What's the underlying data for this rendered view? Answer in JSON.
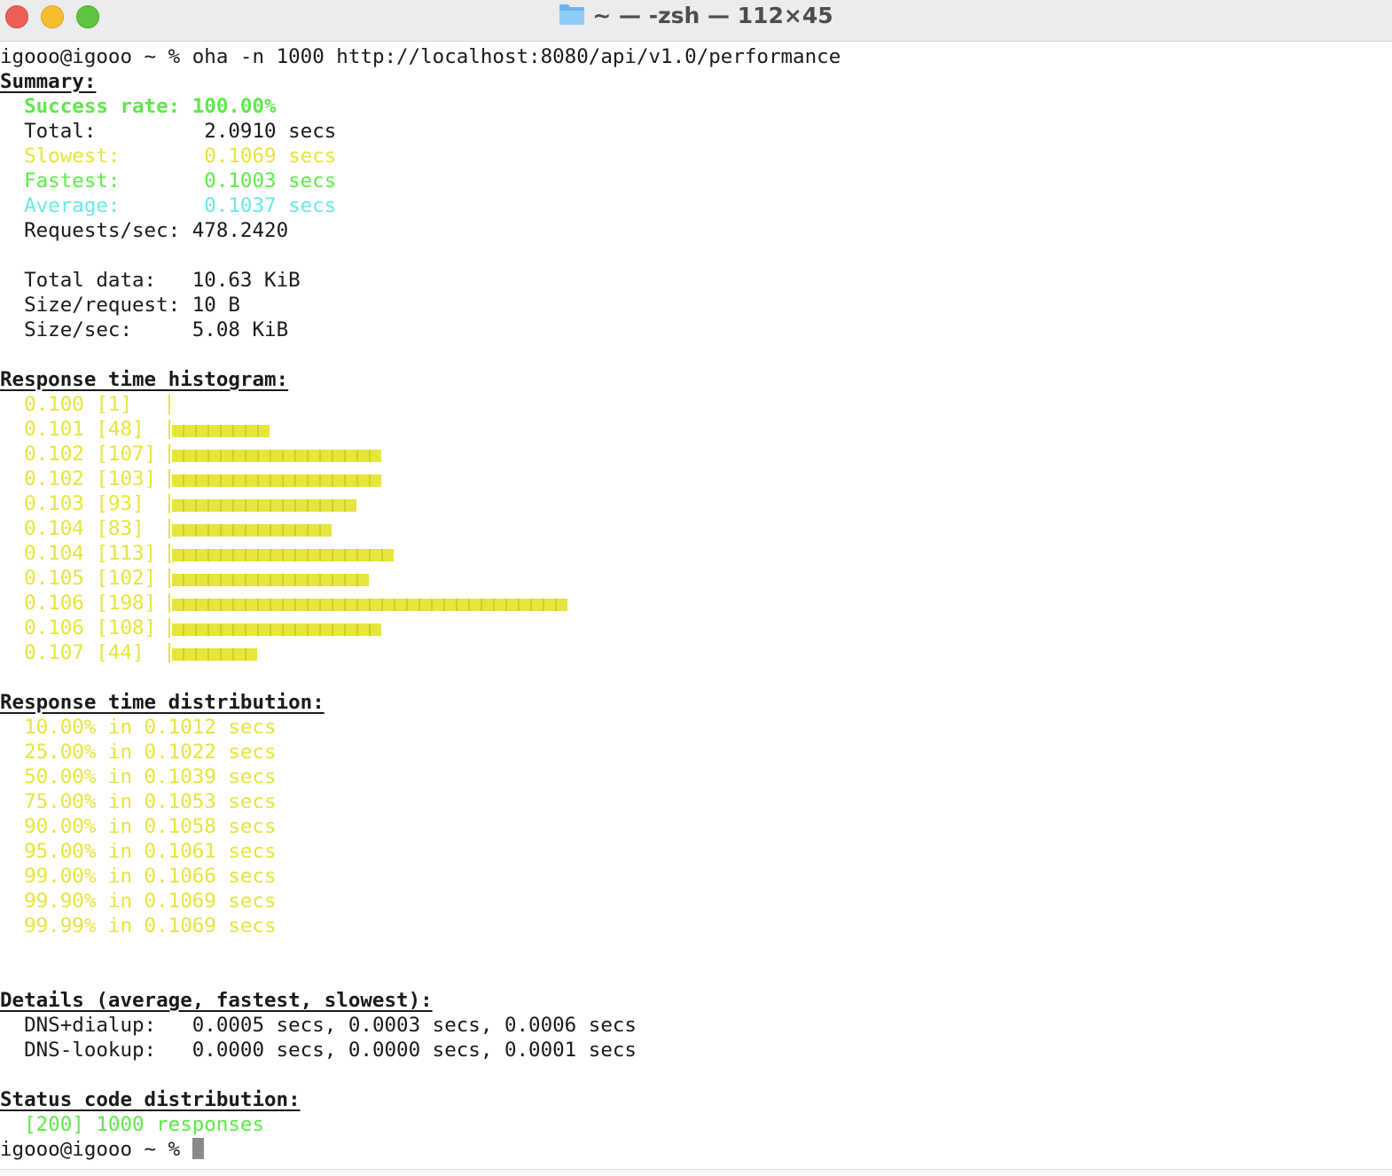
{
  "window": {
    "title": "~ — -zsh — 112×45"
  },
  "command": {
    "prompt": "igooo@igooo ~ % ",
    "text": "oha -n 1000 http://localhost:8080/api/v1.0/performance"
  },
  "summary": {
    "header": "Summary:",
    "success": "Success rate: 100.00%",
    "total_label": "Total:",
    "total_value": "2.0910 secs",
    "slowest_label": "Slowest:",
    "slowest_value": "0.1069 secs",
    "fastest_label": "Fastest:",
    "fastest_value": "0.1003 secs",
    "average_label": "Average:",
    "average_value": "0.1037 secs",
    "rps_label": "Requests/sec:",
    "rps_value": "478.2420",
    "data_label": "Total data:",
    "data_value": "10.63 KiB",
    "size_req_label": "Size/request:",
    "size_req_value": "10 B",
    "size_sec_label": "Size/sec:",
    "size_sec_value": "5.08 KiB"
  },
  "histogram": {
    "header": "Response time histogram:",
    "rows": [
      {
        "label": "0.100 [1]  ",
        "count": 1
      },
      {
        "label": "0.101 [48] ",
        "count": 48
      },
      {
        "label": "0.102 [107]",
        "count": 107
      },
      {
        "label": "0.102 [103]",
        "count": 103
      },
      {
        "label": "0.103 [93] ",
        "count": 93
      },
      {
        "label": "0.104 [83] ",
        "count": 83
      },
      {
        "label": "0.104 [113]",
        "count": 113
      },
      {
        "label": "0.105 [102]",
        "count": 102
      },
      {
        "label": "0.106 [198]",
        "count": 198
      },
      {
        "label": "0.106 [108]",
        "count": 108
      },
      {
        "label": "0.107 [44] ",
        "count": 44
      }
    ]
  },
  "distribution": {
    "header": "Response time distribution:",
    "rows": [
      "10.00% in 0.1012 secs",
      "25.00% in 0.1022 secs",
      "50.00% in 0.1039 secs",
      "75.00% in 0.1053 secs",
      "90.00% in 0.1058 secs",
      "95.00% in 0.1061 secs",
      "99.00% in 0.1066 secs",
      "99.90% in 0.1069 secs",
      "99.99% in 0.1069 secs"
    ]
  },
  "details": {
    "header": "Details (average, fastest, slowest):",
    "dns_dialup_label": "DNS+dialup:",
    "dns_dialup_value": "0.0005 secs, 0.0003 secs, 0.0006 secs",
    "dns_lookup_label": "DNS-lookup:",
    "dns_lookup_value": "0.0000 secs, 0.0000 secs, 0.0001 secs"
  },
  "status": {
    "header": "Status code distribution:",
    "line": "[200] 1000 responses"
  },
  "final_prompt": "igooo@igooo ~ % ",
  "colors": {
    "green": "#5fe84a",
    "yellow": "#e5e53c",
    "cyan": "#6ae8e8"
  }
}
